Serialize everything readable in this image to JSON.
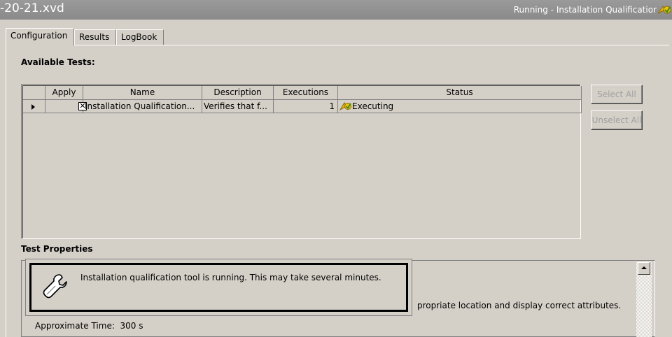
{
  "titlebar": {
    "document": "-20-21.xvd",
    "status": "Running - Installation Qualificatior"
  },
  "tabs": [
    {
      "label": "Configuration",
      "active": true
    },
    {
      "label": "Results",
      "active": false
    },
    {
      "label": "LogBook",
      "active": false
    }
  ],
  "available_tests": {
    "title": "Available Tests:",
    "columns": [
      "Apply",
      "Name",
      "Description",
      "Executions",
      "Status"
    ],
    "rows": [
      {
        "apply_mark": "✕",
        "name": "Installation Qualification...",
        "description": "Verifies that f...",
        "executions": "1",
        "status": "Executing"
      }
    ]
  },
  "buttons": {
    "select_all": "Select All",
    "unselect_all": "Unselect All"
  },
  "test_properties": {
    "title": "Test Properties",
    "desc_fragment": "propriate location and display correct attributes.",
    "approx_label": "Approximate Time:",
    "approx_value": "300 s"
  },
  "popup": {
    "message": "Installation qualification tool is running. This may take several minutes."
  },
  "icons": {
    "status": "executing-icon",
    "popup": "wrench-icon",
    "titlebar": "running-icon"
  },
  "colors": {
    "titlebar": "#8a8a8a",
    "window": "#d4d0c8"
  }
}
